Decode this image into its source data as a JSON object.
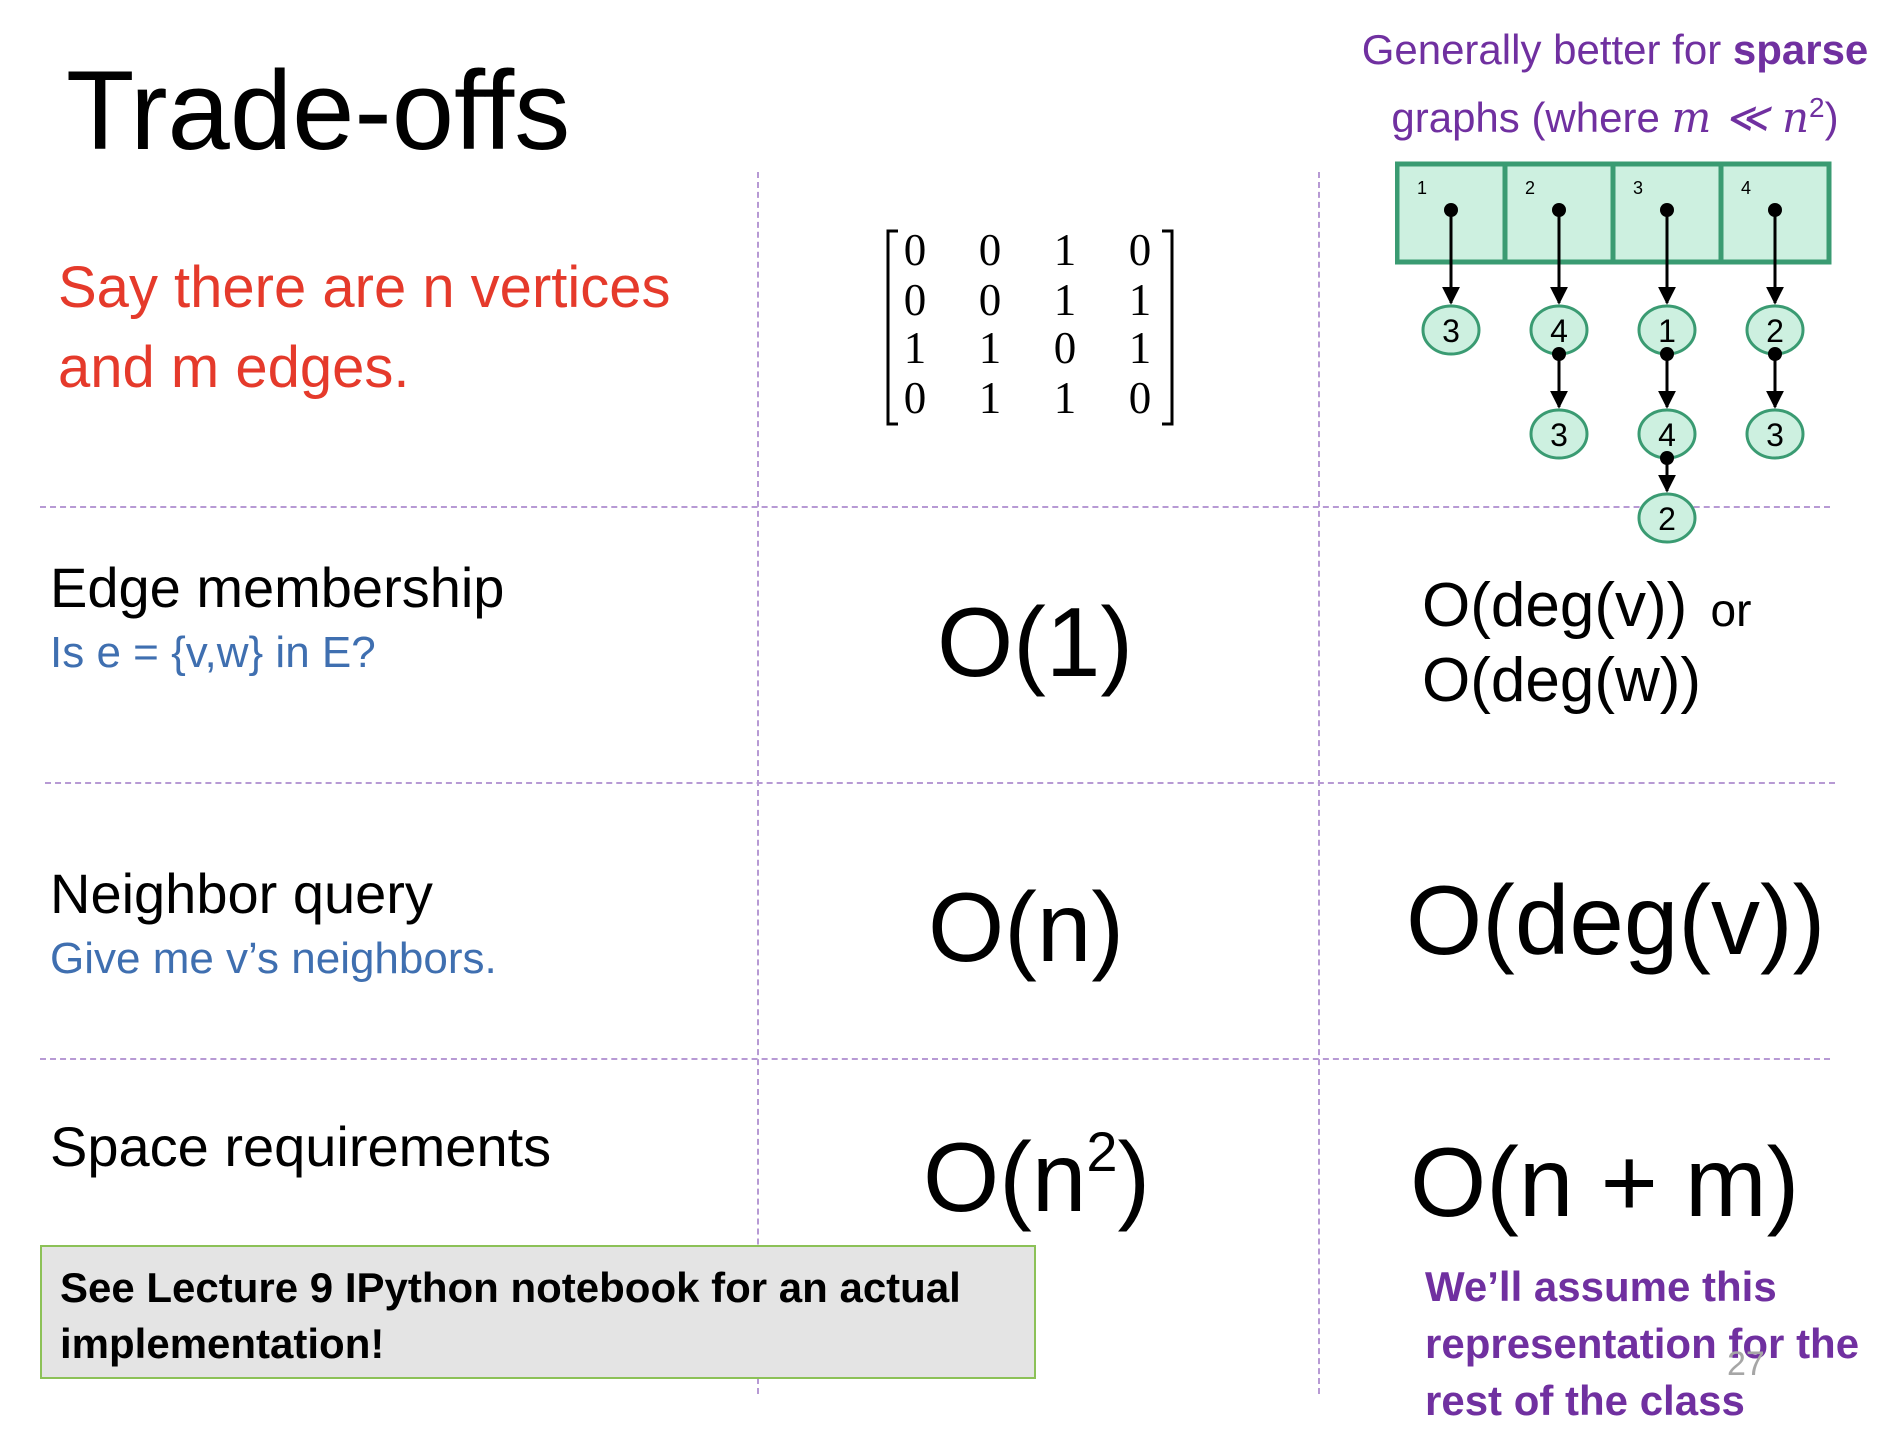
{
  "slide": {
    "title": "Trade-offs",
    "intro": "Say there are n vertices and m edges.",
    "page_number": "27"
  },
  "sparse_note": {
    "prefix": "Generally better for ",
    "bold": "sparse",
    "line2_prefix": "graphs (where ",
    "math": "m ≪ n",
    "math_exp": "2",
    "suffix": ")"
  },
  "matrix": {
    "rows": [
      [
        "0",
        "0",
        "1",
        "0"
      ],
      [
        "0",
        "0",
        "1",
        "1"
      ],
      [
        "1",
        "1",
        "0",
        "1"
      ],
      [
        "0",
        "1",
        "1",
        "0"
      ]
    ]
  },
  "adjacency_list": {
    "slots": [
      {
        "label": "1",
        "neighbors": [
          "3"
        ]
      },
      {
        "label": "2",
        "neighbors": [
          "4",
          "3"
        ]
      },
      {
        "label": "3",
        "neighbors": [
          "1",
          "4",
          "2"
        ]
      },
      {
        "label": "4",
        "neighbors": [
          "2",
          "3"
        ]
      }
    ],
    "colors": {
      "fill": "#cdf0e0",
      "stroke": "#3a9b72"
    }
  },
  "rows": [
    {
      "label": "Edge membership",
      "sub": "Is e = {v,w} in E?",
      "matrix_cost": "O(1)",
      "list_cost_line1": "O(deg(v))",
      "list_cost_or": "or",
      "list_cost_line2": "O(deg(w))"
    },
    {
      "label": "Neighbor query",
      "sub": "Give me v’s neighbors.",
      "matrix_cost": "O(n)",
      "list_cost": "O(deg(v))"
    },
    {
      "label": "Space requirements",
      "matrix_cost_base": "O(n",
      "matrix_cost_exp": "2",
      "matrix_cost_end": ")",
      "list_cost": "O(n + m)"
    }
  ],
  "callout": "See Lecture 9 IPython notebook for an actual implementation!",
  "assumption_note": "We’ll assume this representation for the rest of the class"
}
